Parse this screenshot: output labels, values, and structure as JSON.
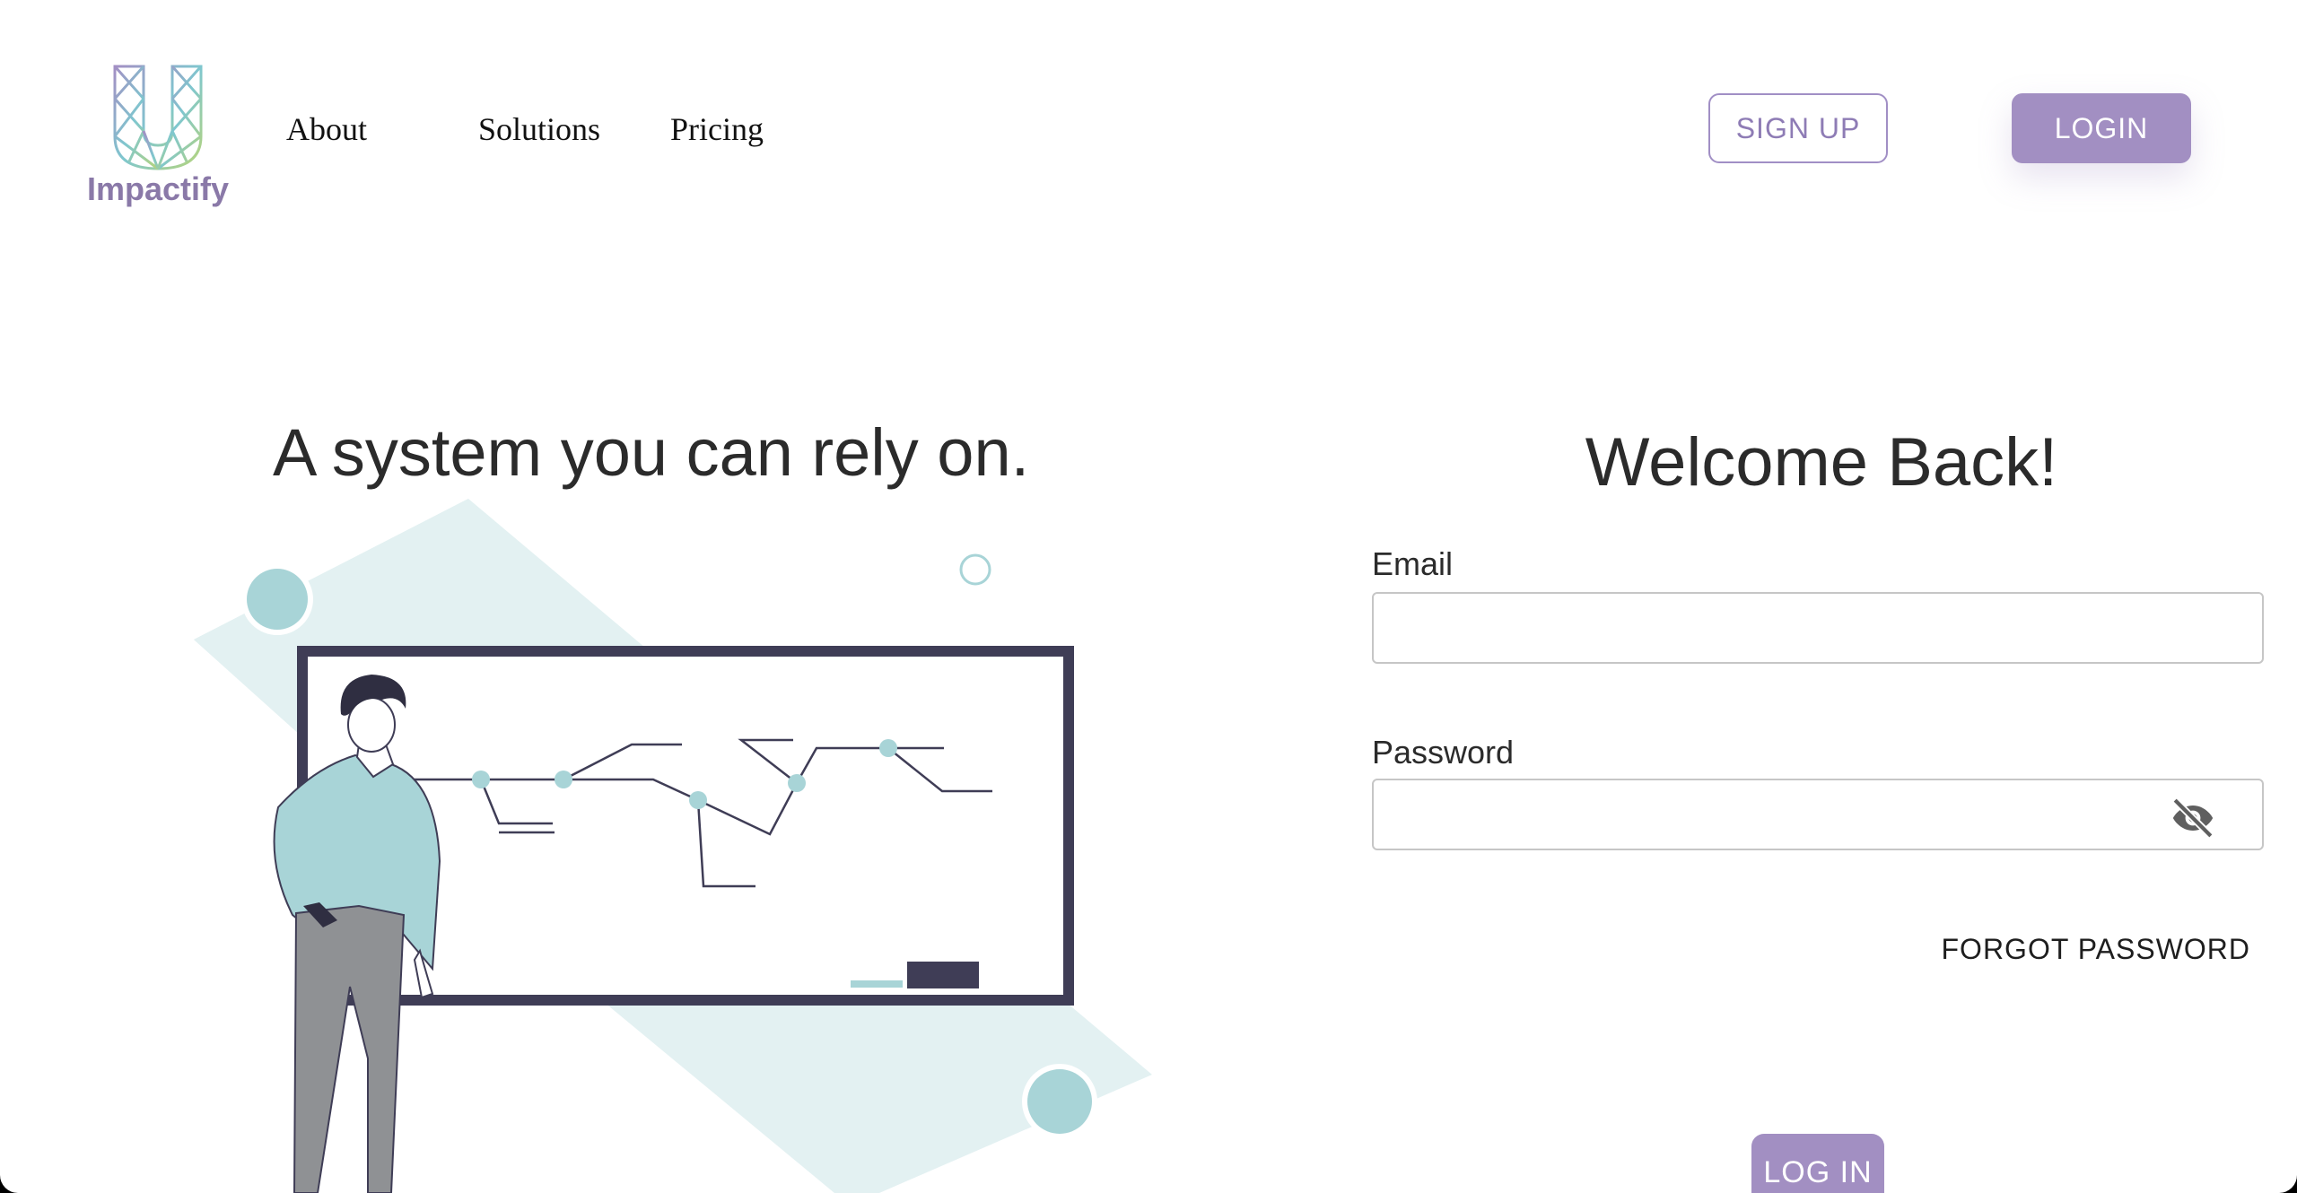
{
  "brand": {
    "name": "Impactify",
    "logo_icon": "impactify-u-logo"
  },
  "nav": {
    "items": [
      "About",
      "Solutions",
      "Pricing"
    ]
  },
  "header": {
    "signup_label": "SIGN UP",
    "login_label": "LOGIN"
  },
  "hero": {
    "title": "A system you can rely on.",
    "illustration": "man-presenting-at-whiteboard"
  },
  "form": {
    "heading": "Welcome Back!",
    "email_label": "Email",
    "email_value": "",
    "password_label": "Password",
    "password_value": "",
    "password_toggle_icon": "eye-slash-icon",
    "forgot_label": "FORGOT PASSWORD",
    "submit_label": "LOG IN"
  },
  "colors": {
    "accent": "#a28fc2",
    "teal": "#a8d4d7",
    "teal_light": "#e3f1f2",
    "board_frame": "#3f3d56",
    "text": "#2b2b2b"
  }
}
